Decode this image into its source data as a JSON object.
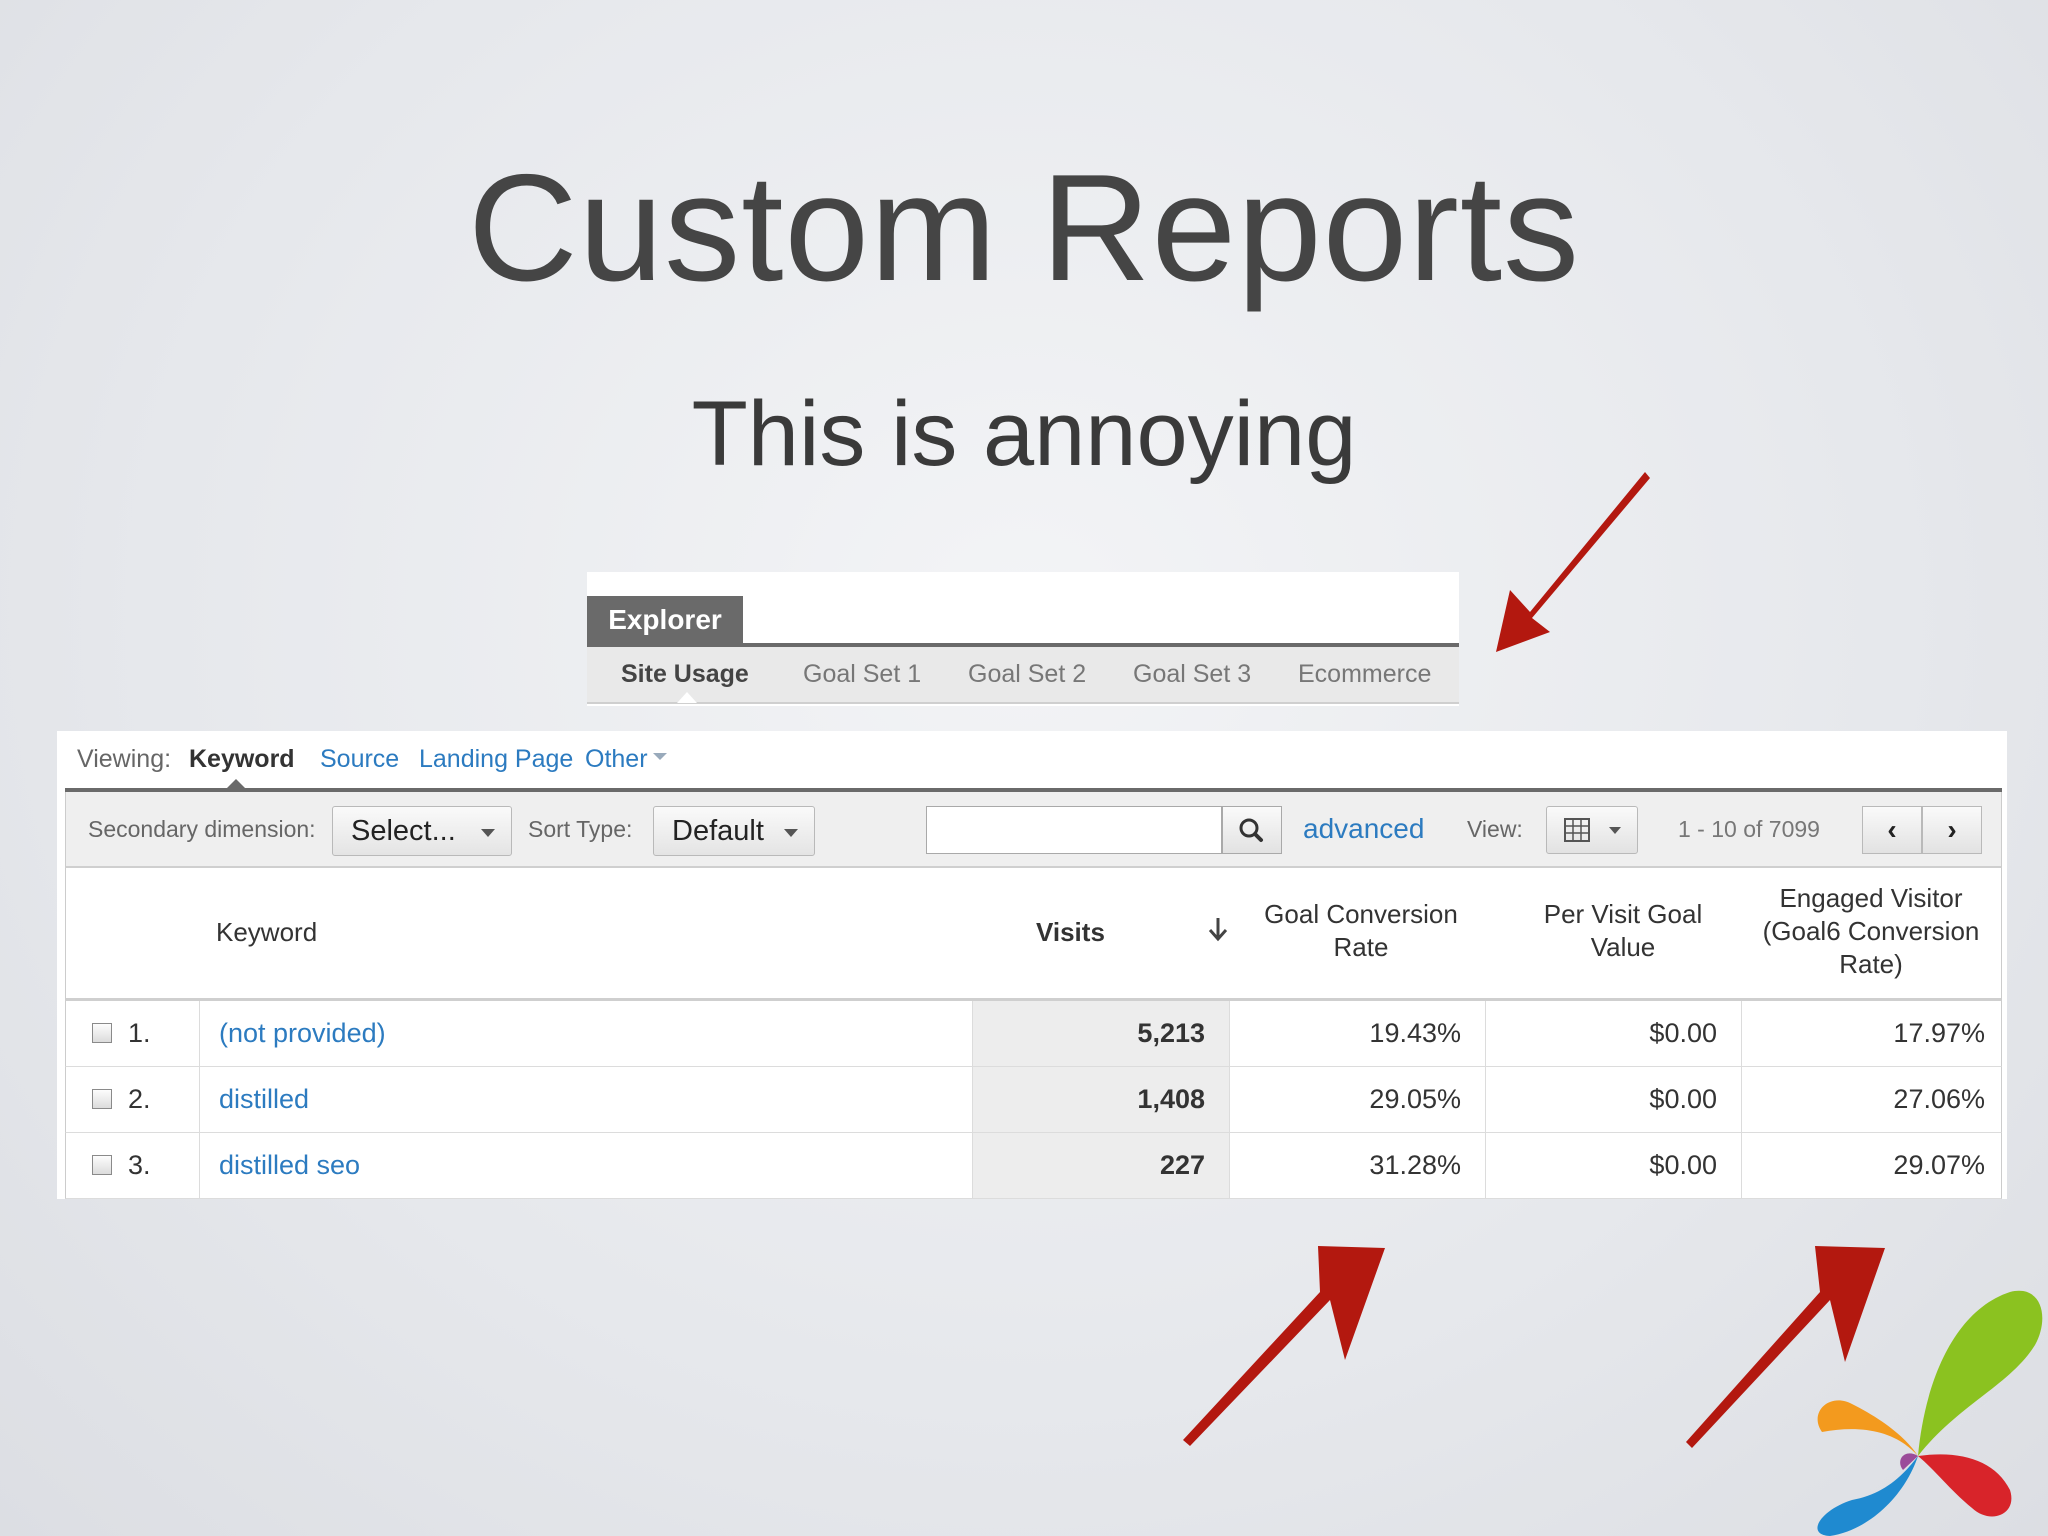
{
  "slide": {
    "title": "Custom Reports",
    "subtitle": "This is annoying"
  },
  "explorer": {
    "tab_label": "Explorer",
    "subtabs": [
      "Site Usage",
      "Goal Set 1",
      "Goal Set 2",
      "Goal Set 3",
      "Ecommerce"
    ],
    "active_subtab": "Site Usage"
  },
  "viewing": {
    "label": "Viewing:",
    "active": "Keyword",
    "links": [
      "Source",
      "Landing Page",
      "Other"
    ]
  },
  "toolbar": {
    "secondary_label": "Secondary dimension:",
    "secondary_value": "Select...",
    "sort_label": "Sort Type:",
    "sort_value": "Default",
    "search_value": "",
    "advanced_label": "advanced",
    "view_label": "View:",
    "pager_text": "1 - 10 of 7099",
    "prev_glyph": "‹",
    "next_glyph": "›"
  },
  "table": {
    "headers": {
      "keyword": "Keyword",
      "visits": "Visits",
      "goal_conv_l1": "Goal Conversion",
      "goal_conv_l2": "Rate",
      "per_visit_l1": "Per Visit Goal",
      "per_visit_l2": "Value",
      "engaged_l1": "Engaged Visitor",
      "engaged_l2": "(Goal6 Conversion",
      "engaged_l3": "Rate)"
    },
    "rows": [
      {
        "index": "1.",
        "keyword": "(not provided)",
        "visits": "5,213",
        "goal_conv": "19.43%",
        "per_visit": "$0.00",
        "engaged": "17.97%"
      },
      {
        "index": "2.",
        "keyword": "distilled",
        "visits": "1,408",
        "goal_conv": "29.05%",
        "per_visit": "$0.00",
        "engaged": "27.06%"
      },
      {
        "index": "3.",
        "keyword": "distilled seo",
        "visits": "227",
        "goal_conv": "31.28%",
        "per_visit": "$0.00",
        "engaged": "29.07%"
      }
    ]
  },
  "colors": {
    "arrow": "#b3180f",
    "link": "#2c7bc0",
    "tab_bg": "#6a6a6a"
  }
}
